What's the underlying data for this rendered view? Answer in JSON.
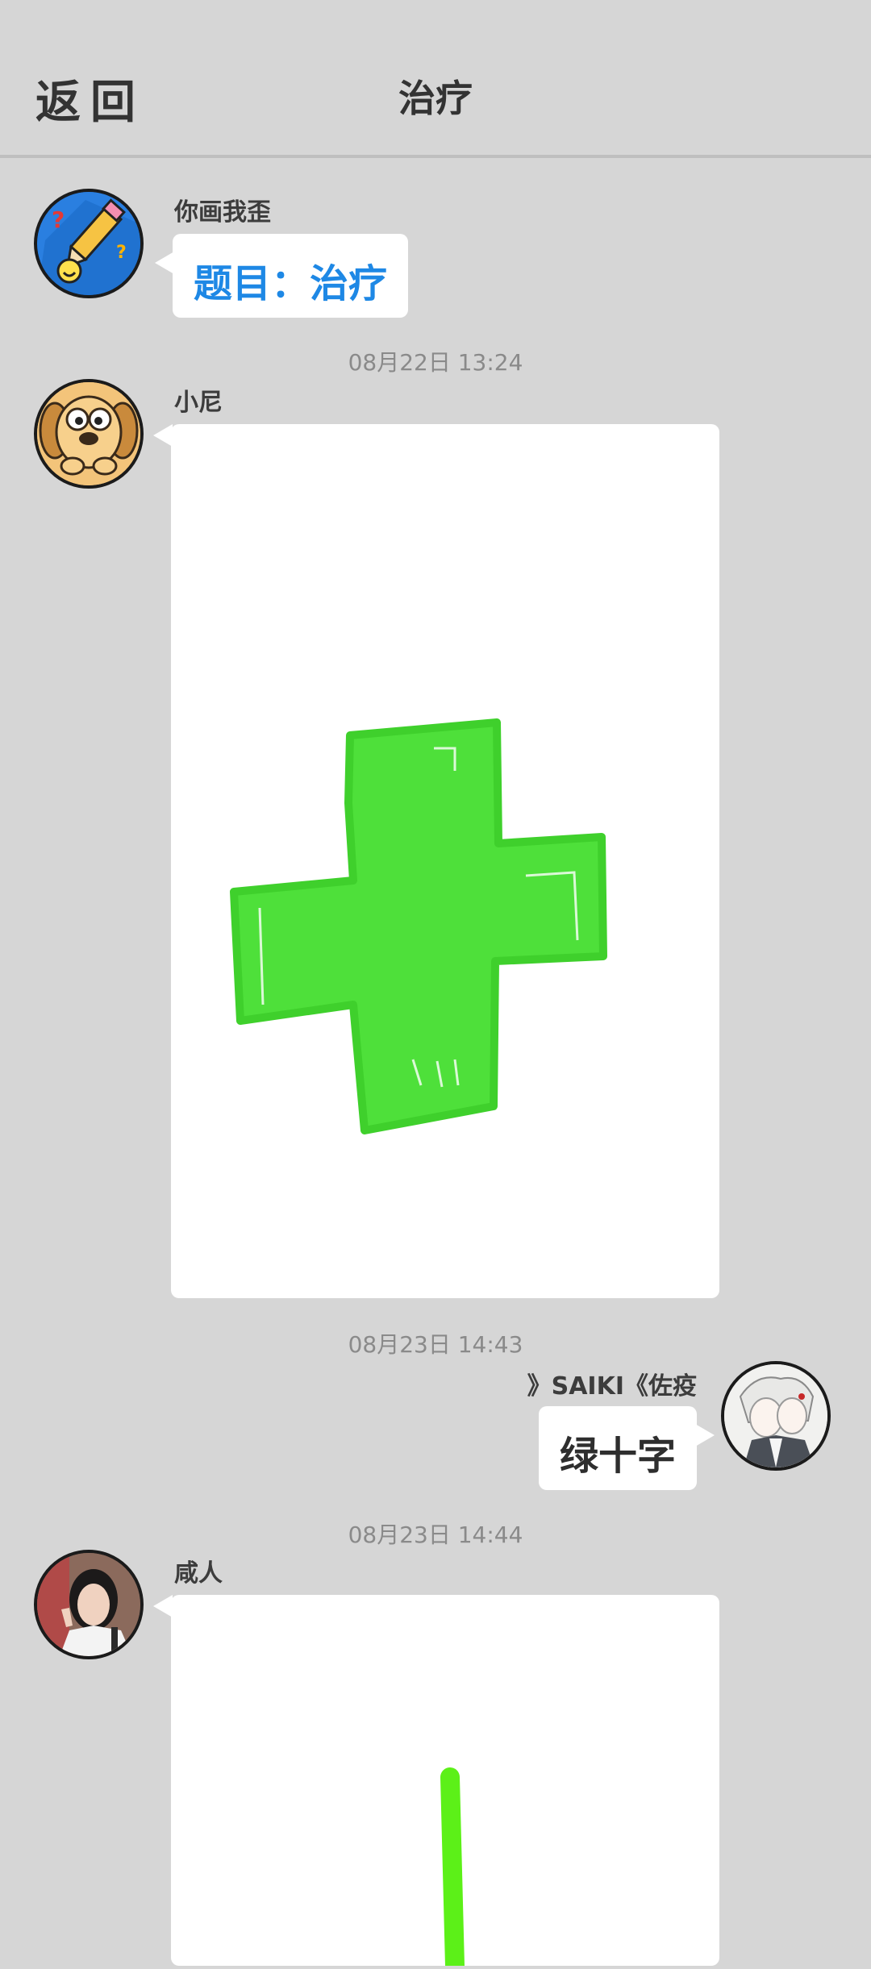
{
  "header": {
    "back_label": "返回",
    "title": "治疗"
  },
  "messages": [
    {
      "sender": "你画我歪",
      "text": "题目：治疗",
      "avatar": "pencil-game-logo-icon",
      "accent": "#1e88e5"
    },
    {
      "time": "08月22日  13:24",
      "sender": "小尼",
      "drawing": "green-cross-drawing",
      "avatar": "cartoon-dog-avatar",
      "stroke": "#4ee03a"
    },
    {
      "time": "08月23日  14:43",
      "sender": "》SAIKI《佐疫",
      "text": "绿十字",
      "avatar": "anime-character-avatar"
    },
    {
      "time": "08月23日  14:44",
      "sender": "咸人",
      "drawing": "green-line-drawing",
      "avatar": "user-photo-avatar",
      "stroke": "#5cf018"
    }
  ],
  "colors": {
    "background": "#d6d6d6",
    "bubble": "#ffffff",
    "accent_blue": "#1e88e5"
  }
}
